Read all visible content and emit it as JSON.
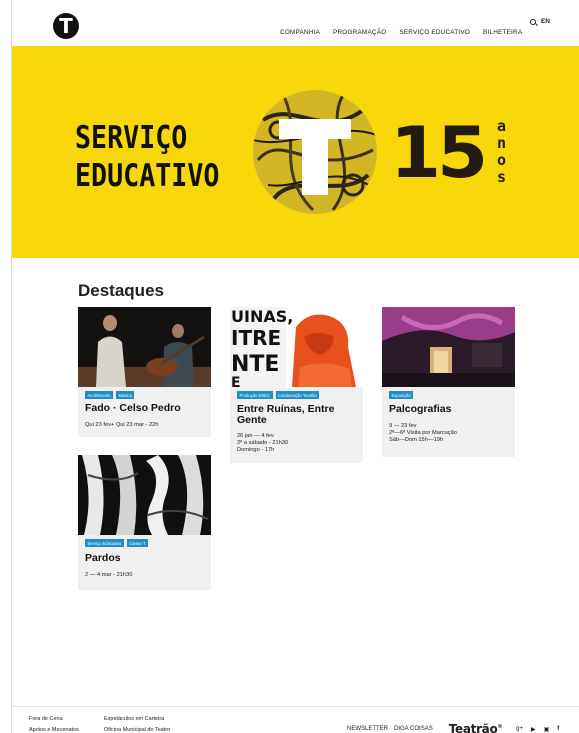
{
  "header": {
    "logo_letter": "T",
    "nav": [
      "COMPANHIA",
      "PROGRAMAÇÃO",
      "SERVIÇO EDUCATIVO",
      "BILHETEIRA"
    ],
    "lang": "EN"
  },
  "banner": {
    "line1": "SERVIÇO",
    "line2": "EDUCATIVO",
    "number": "15",
    "anos": [
      "a",
      "n",
      "o",
      "s"
    ],
    "colors": {
      "background": "#f7d70a",
      "text": "#231a12"
    }
  },
  "section": {
    "title": "Destaques"
  },
  "cards": [
    {
      "tags": [
        "Acolhimento",
        "Música"
      ],
      "title": "Fado · Celso Pedro",
      "date": "Qui 23 fev+ Qui 23 mar - 22h"
    },
    {
      "tags": [
        "Produção ESEC",
        "Colaboração Teatrão"
      ],
      "title": "Entre Ruínas, Entre Gente",
      "date": "26 jan — 4 fev\n2ª a sábado - 21h30\nDomingo - 17h"
    },
    {
      "tags": [
        "Exposição"
      ],
      "title": "Palcografias",
      "date": "9 — 23 fev\n2ª—6ª Visita por Marcação\nSáb—Dom 15h—19h"
    },
    {
      "tags": [
        "Serviço Educativo",
        "Classe T"
      ],
      "title": "Pardos",
      "date": "2 — 4 mar - 21h30"
    }
  ],
  "footer": {
    "col1": [
      "Fora de Cena",
      "Apoios e Mecenatos"
    ],
    "col2": [
      "Espetáculos em Carteira",
      "Oficina Municipal do Teatro"
    ],
    "links": [
      "NEWSLETTER",
      "DIGA COISAS"
    ],
    "brand": "Teatrão",
    "social": [
      "g+",
      "youtube",
      "instagram",
      "facebook"
    ]
  },
  "accent": "#1e8fc6"
}
